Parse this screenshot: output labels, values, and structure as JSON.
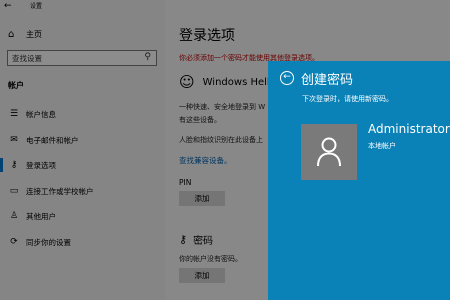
{
  "window": {
    "title": "设置",
    "back_glyph": "←"
  },
  "sidebar": {
    "home_label": "主页",
    "search_placeholder": "查找设置",
    "section_title": "帐户",
    "items": [
      {
        "label": "帐户信息",
        "icon": "person-card-icon"
      },
      {
        "label": "电子邮件和帐户",
        "icon": "mail-icon"
      },
      {
        "label": "登录选项",
        "icon": "key-icon",
        "active": true
      },
      {
        "label": "连接工作或学校帐户",
        "icon": "briefcase-icon"
      },
      {
        "label": "其他用户",
        "icon": "person-add-icon"
      },
      {
        "label": "同步你的设置",
        "icon": "sync-icon"
      }
    ]
  },
  "main": {
    "page_title": "登录选项",
    "warning": "你必须添加一个密码才能使用其他登录选项。",
    "hello_title": "Windows Hello",
    "hello_desc_1": "一种快速、安全地登录到 W",
    "hello_desc_2": "有这些设备。",
    "hello_desc_3": "人脸和指纹识别在此设备上",
    "compat_link": "查找兼容设备。",
    "pin_label": "PIN",
    "pin_add_label": "添加",
    "password_title": "密码",
    "password_desc": "你的帐户没有密码。",
    "password_add_label": "添加"
  },
  "dialog": {
    "title": "创建密码",
    "subtitle": "下次登录时，请使用新密码。",
    "user_name": "Administrator",
    "user_type": "本地帐户",
    "accent_color": "#0a82b8"
  }
}
